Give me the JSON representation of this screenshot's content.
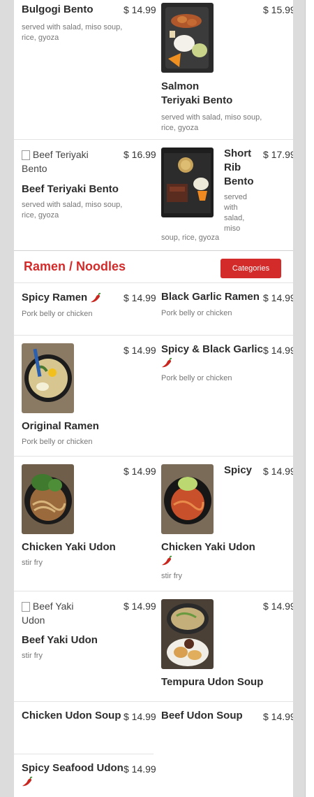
{
  "colors": {
    "accent": "#d32a2a",
    "background": "#dcdcdc"
  },
  "bento": [
    {
      "name": "Bulgogi Bento",
      "price": "$ 14.99",
      "desc": "served with salad, miso soup, rice, gyoza"
    },
    {
      "name": "Salmon Teriyaki Bento",
      "price": "$ 15.99",
      "desc": "served with salad, miso soup, rice, gyoza"
    },
    {
      "name": "Beef Teriyaki Bento",
      "price": "$ 16.99",
      "desc": "served with salad, miso soup, rice, gyoza",
      "img_alt": "Beef Teriyaki Bento"
    },
    {
      "name_lines": [
        "Short",
        "Rib",
        "Bento"
      ],
      "price": "$ 17.99",
      "desc_lines": [
        "served",
        "with",
        "salad,",
        "miso",
        "soup, rice, gyoza"
      ]
    }
  ],
  "section": {
    "title": "Ramen / Noodles",
    "categories_label": "Categories"
  },
  "ramen": [
    {
      "name": "Spicy Ramen",
      "price": "$ 14.99",
      "desc": "Pork belly or chicken",
      "icon": "chili-pepper-icon"
    },
    {
      "name": "Black Garlic Ramen",
      "price": "$ 14.99",
      "desc": "Pork belly or chicken"
    },
    {
      "name": "Original Ramen",
      "price": "$ 14.99",
      "desc": "Pork belly or chicken"
    },
    {
      "name": "Spicy & Black Garlic",
      "price": "$ 14.99",
      "desc": "Pork belly or chicken",
      "icon": "chili-pepper-icon"
    },
    {
      "name": "Chicken Yaki Udon",
      "price": "$ 14.99",
      "desc": "stir fry"
    },
    {
      "name_top": "Spicy",
      "name": "Chicken Yaki Udon",
      "price": "$ 14.99",
      "desc": "stir fry",
      "icon": "chili-pepper-icon"
    },
    {
      "name": "Beef Yaki Udon",
      "price": "$ 14.99",
      "desc": "stir fry",
      "img_alt": "Beef Yaki Udon"
    },
    {
      "name": "Tempura Udon Soup",
      "price": "$ 14.99"
    },
    {
      "name": "Chicken Udon Soup",
      "price": "$ 14.99"
    },
    {
      "name": "Beef Udon Soup",
      "price": "$ 14.99"
    },
    {
      "name": "Spicy Seafood Udon",
      "price": "$ 14.99",
      "icon": "chili-pepper-icon"
    }
  ]
}
